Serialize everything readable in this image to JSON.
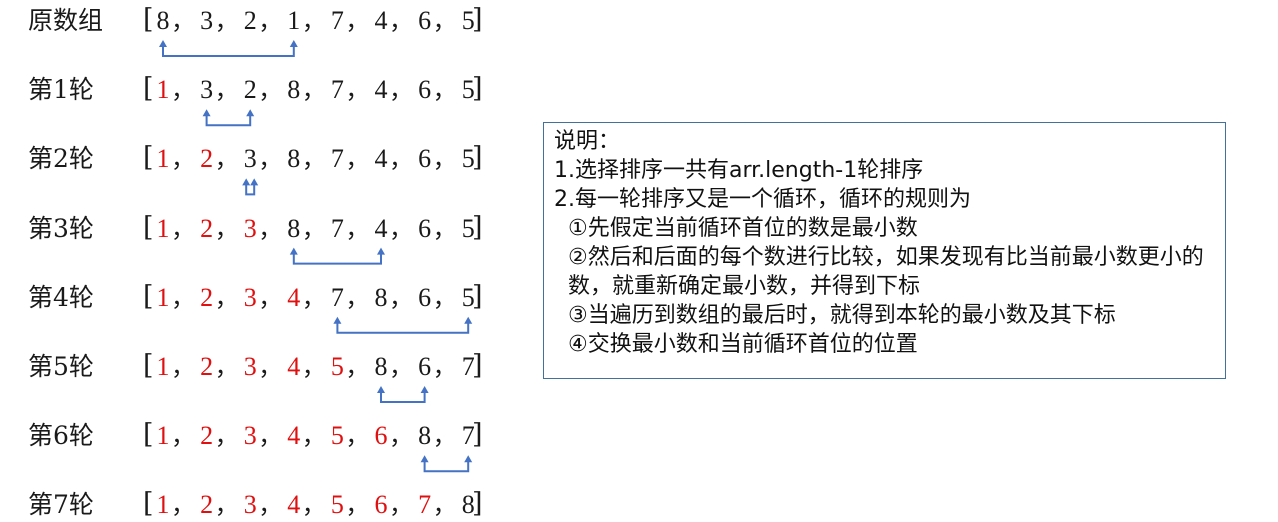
{
  "rows": [
    {
      "label": "原数组",
      "values": [
        "8",
        "3",
        "2",
        "1",
        "7",
        "4",
        "6",
        "5"
      ],
      "sorted_count": 0,
      "swap": [
        0,
        3
      ]
    },
    {
      "label": "第1轮",
      "values": [
        "1",
        "3",
        "2",
        "8",
        "7",
        "4",
        "6",
        "5"
      ],
      "sorted_count": 1,
      "swap": [
        1,
        2
      ]
    },
    {
      "label": "第2轮",
      "values": [
        "1",
        "2",
        "3",
        "8",
        "7",
        "4",
        "6",
        "5"
      ],
      "sorted_count": 2,
      "swap": [
        2,
        2
      ]
    },
    {
      "label": "第3轮",
      "values": [
        "1",
        "2",
        "3",
        "8",
        "7",
        "4",
        "6",
        "5"
      ],
      "sorted_count": 3,
      "swap": [
        3,
        5
      ]
    },
    {
      "label": "第4轮",
      "values": [
        "1",
        "2",
        "3",
        "4",
        "7",
        "8",
        "6",
        "5"
      ],
      "sorted_count": 4,
      "swap": [
        4,
        7
      ]
    },
    {
      "label": "第5轮",
      "values": [
        "1",
        "2",
        "3",
        "4",
        "5",
        "8",
        "6",
        "7"
      ],
      "sorted_count": 5,
      "swap": [
        5,
        6
      ]
    },
    {
      "label": "第6轮",
      "values": [
        "1",
        "2",
        "3",
        "4",
        "5",
        "6",
        "8",
        "7"
      ],
      "sorted_count": 6,
      "swap": [
        6,
        7
      ]
    },
    {
      "label": "第7轮",
      "values": [
        "1",
        "2",
        "3",
        "4",
        "5",
        "6",
        "7",
        "8"
      ],
      "sorted_count": 7,
      "swap": null
    }
  ],
  "punct": {
    "open": "[",
    "close": "]",
    "sep": "，"
  },
  "colors": {
    "sorted": "#e01010",
    "normal": "#1a1a1a",
    "arrow": "#4472c4",
    "box_border": "#41719c"
  },
  "note": {
    "title": "说明：",
    "line1": "1.选择排序一共有arr.length-1轮排序",
    "line2": "2.每一轮排序又是一个循环，循环的规则为",
    "step1": "①先假定当前循环首位的数是最小数",
    "step2": "②然后和后面的每个数进行比较，如果发现有比当前最小数更小的数，就重新确定最小数，并得到下标",
    "step3": "③当遍历到数组的最后时，就得到本轮的最小数及其下标",
    "step4": "④交换最小数和当前循环首位的位置"
  }
}
